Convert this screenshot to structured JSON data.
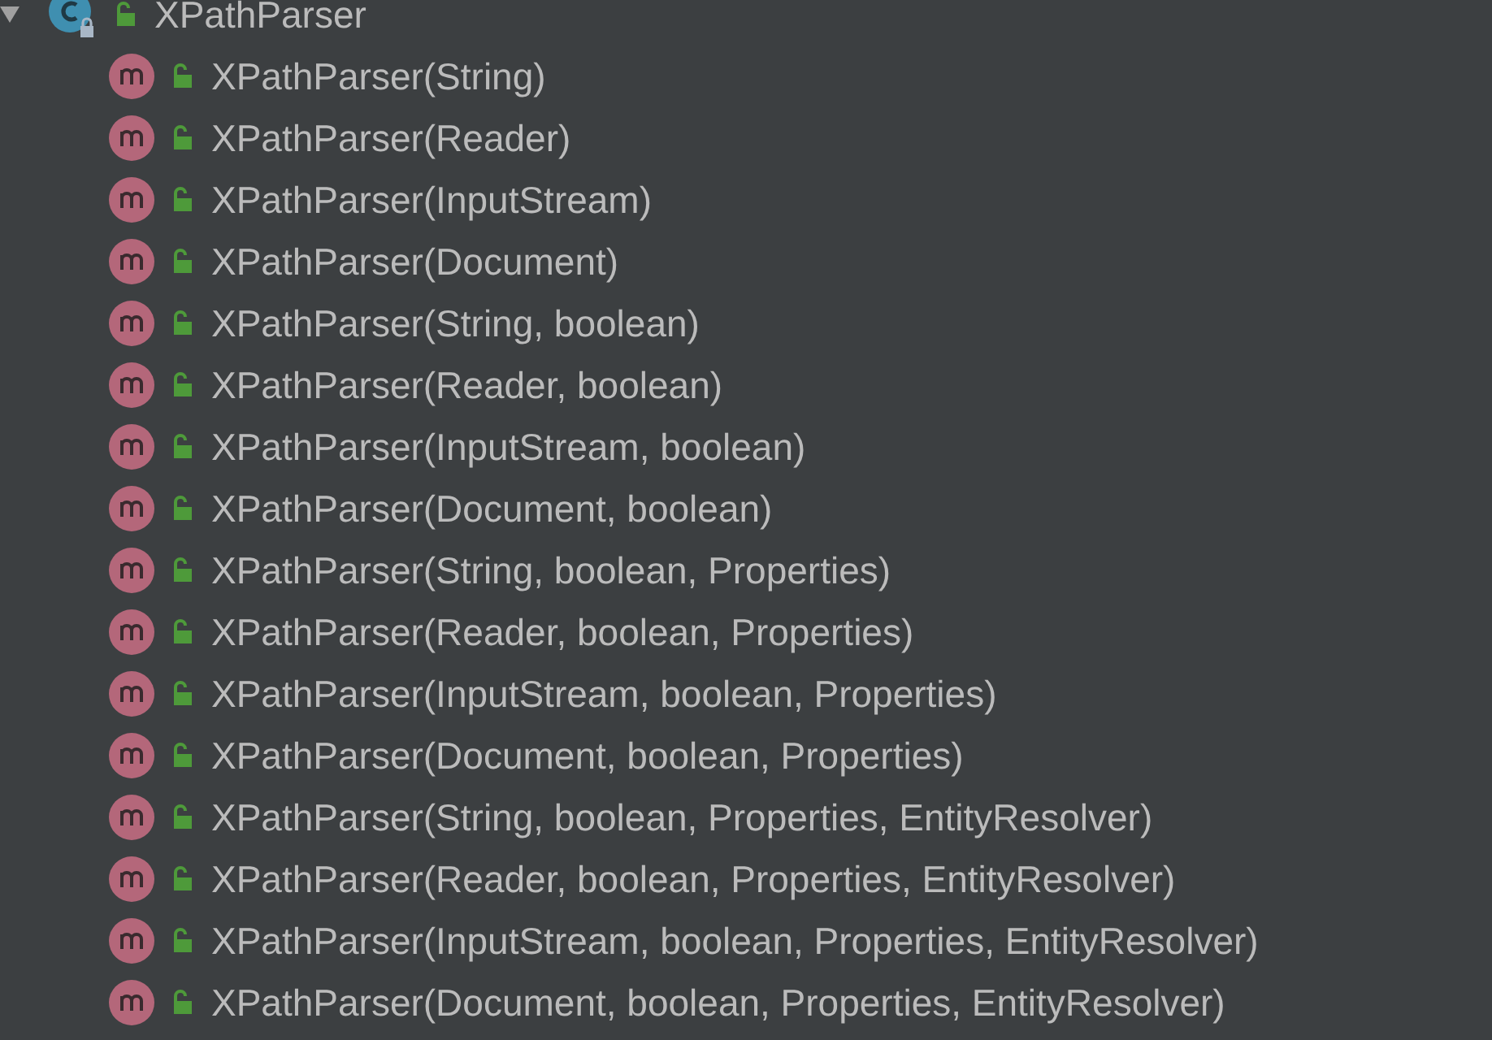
{
  "tree": {
    "label": "XPathParser",
    "kind": "class",
    "expanded": true,
    "children": [
      {
        "label": "XPathParser(String)",
        "kind": "method"
      },
      {
        "label": "XPathParser(Reader)",
        "kind": "method"
      },
      {
        "label": "XPathParser(InputStream)",
        "kind": "method"
      },
      {
        "label": "XPathParser(Document)",
        "kind": "method"
      },
      {
        "label": "XPathParser(String, boolean)",
        "kind": "method"
      },
      {
        "label": "XPathParser(Reader, boolean)",
        "kind": "method"
      },
      {
        "label": "XPathParser(InputStream, boolean)",
        "kind": "method"
      },
      {
        "label": "XPathParser(Document, boolean)",
        "kind": "method"
      },
      {
        "label": "XPathParser(String, boolean, Properties)",
        "kind": "method"
      },
      {
        "label": "XPathParser(Reader, boolean, Properties)",
        "kind": "method"
      },
      {
        "label": "XPathParser(InputStream, boolean, Properties)",
        "kind": "method"
      },
      {
        "label": "XPathParser(Document, boolean, Properties)",
        "kind": "method"
      },
      {
        "label": "XPathParser(String, boolean, Properties, EntityResolver)",
        "kind": "method"
      },
      {
        "label": "XPathParser(Reader, boolean, Properties, EntityResolver)",
        "kind": "method"
      },
      {
        "label": "XPathParser(InputStream, boolean, Properties, EntityResolver)",
        "kind": "method"
      },
      {
        "label": "XPathParser(Document, boolean, Properties, EntityResolver)",
        "kind": "method"
      }
    ]
  }
}
